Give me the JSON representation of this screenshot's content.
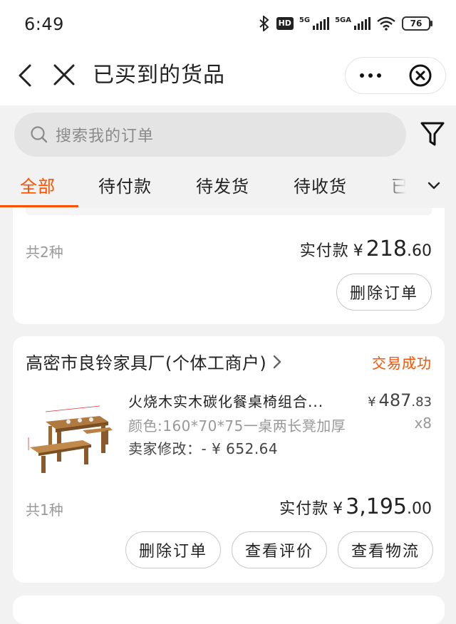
{
  "status_bar": {
    "time": "6:49",
    "hd_label": "HD",
    "net1": "5G",
    "net2": "5GA",
    "battery": "76"
  },
  "nav": {
    "title": "已买到的货品"
  },
  "search": {
    "placeholder": "搜索我的订单"
  },
  "tabs": [
    {
      "label": "全部",
      "active": true
    },
    {
      "label": "待付款"
    },
    {
      "label": "待发货"
    },
    {
      "label": "待收货"
    },
    {
      "label": "已"
    }
  ],
  "order1": {
    "count": "共2种",
    "paid_label": "实付款",
    "currency": "¥",
    "paid_int": "218",
    "paid_dec": ".60",
    "buttons": [
      "删除订单"
    ]
  },
  "order2": {
    "shop_name": "高密市良铃家具厂(个体工商户)",
    "status": "交易成功",
    "product_name": "火烧木实木碳化餐桌椅组合...",
    "spec": "颜色:160*70*75一桌两长凳加厚",
    "seller_modified": "卖家修改：- ¥ 652.64",
    "unit_currency": "¥",
    "unit_int": "487",
    "unit_dec": ".83",
    "quantity": "x8",
    "count": "共1种",
    "paid_label": "实付款",
    "currency": "¥",
    "paid_int": "3,195",
    "paid_dec": ".00",
    "buttons": [
      "删除订单",
      "查看评价",
      "查看物流"
    ]
  },
  "colors": {
    "accent": "#ff5000",
    "background": "#f2f2f2"
  }
}
